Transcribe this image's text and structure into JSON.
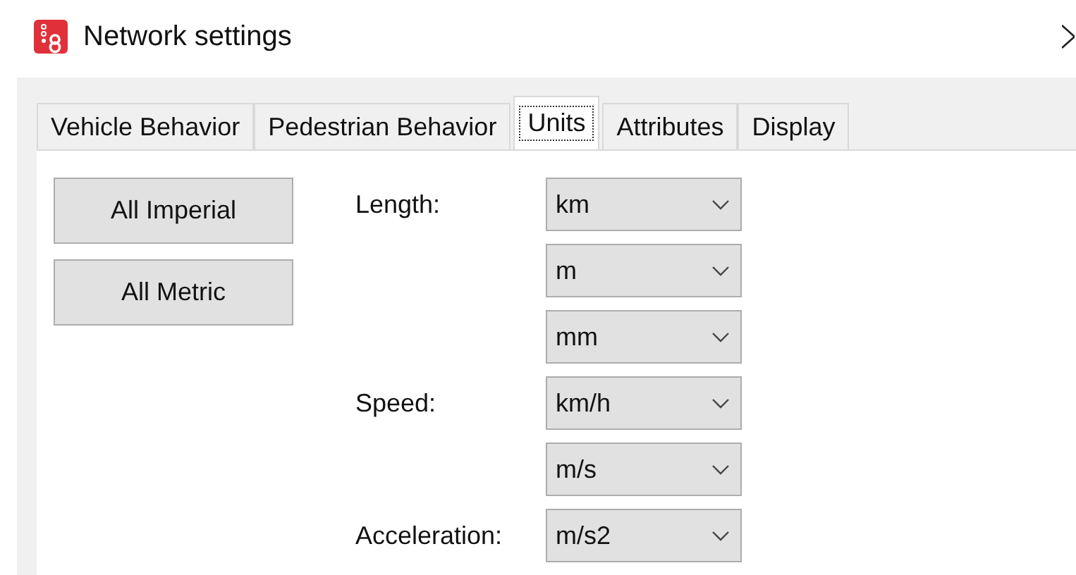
{
  "window": {
    "title": "Network settings"
  },
  "tabs": [
    {
      "label": "Vehicle Behavior",
      "selected": false
    },
    {
      "label": "Pedestrian Behavior",
      "selected": false
    },
    {
      "label": "Units",
      "selected": true
    },
    {
      "label": "Attributes",
      "selected": false
    },
    {
      "label": "Display",
      "selected": false
    }
  ],
  "buttons": [
    "All Imperial",
    "All Metric"
  ],
  "units": [
    {
      "label": "Length:",
      "value": "km"
    },
    {
      "value": "m"
    },
    {
      "value": "mm"
    },
    {
      "label": "Speed:",
      "value": "km/h"
    },
    {
      "value": "m/s"
    },
    {
      "label": "Acceleration:",
      "value": "m/s2"
    }
  ]
}
